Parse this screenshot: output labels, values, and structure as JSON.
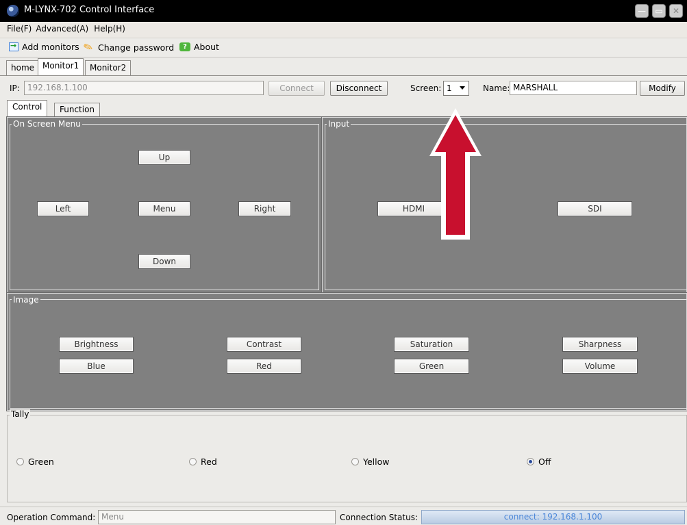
{
  "window": {
    "title": "M-LYNX-702 Control Interface",
    "minimize": "—",
    "maximize": "▭",
    "close": "✕"
  },
  "menu": {
    "file": "File(F)",
    "advanced": "Advanced(A)",
    "help": "Help(H)"
  },
  "toolbar": {
    "add_monitors": "Add monitors",
    "change_password": "Change password",
    "about": "About"
  },
  "monitor_tabs": [
    "home",
    "Monitor1",
    "Monitor2"
  ],
  "connection": {
    "ip_label": "IP:",
    "ip_value": "192.168.1.100",
    "connect": "Connect",
    "disconnect": "Disconnect",
    "screen_label": "Screen:",
    "screen_value": "1",
    "name_label": "Name:",
    "name_value": "MARSHALL",
    "modify": "Modify"
  },
  "sub_tabs": [
    "Control",
    "Function"
  ],
  "osm": {
    "title": "On Screen Menu",
    "up": "Up",
    "left": "Left",
    "menu": "Menu",
    "right": "Right",
    "down": "Down"
  },
  "input": {
    "title": "Input",
    "hdmi": "HDMI",
    "sdi": "SDI"
  },
  "image": {
    "title": "Image",
    "row1": [
      "Brightness",
      "Contrast",
      "Saturation",
      "Sharpness"
    ],
    "row2": [
      "Blue",
      "Red",
      "Green",
      "Volume"
    ]
  },
  "tally": {
    "title": "Tally",
    "options": [
      "Green",
      "Red",
      "Yellow",
      "Off"
    ],
    "selected": "Off"
  },
  "status": {
    "operation_label": "Operation Command:",
    "operation_value": "Menu",
    "connection_label": "Connection Status:",
    "connection_value": "connect: 192.168.1.100"
  },
  "colors": {
    "panel_bg": "#808080",
    "annotation_arrow": "#c8102e",
    "status_text": "#4a86d8"
  }
}
